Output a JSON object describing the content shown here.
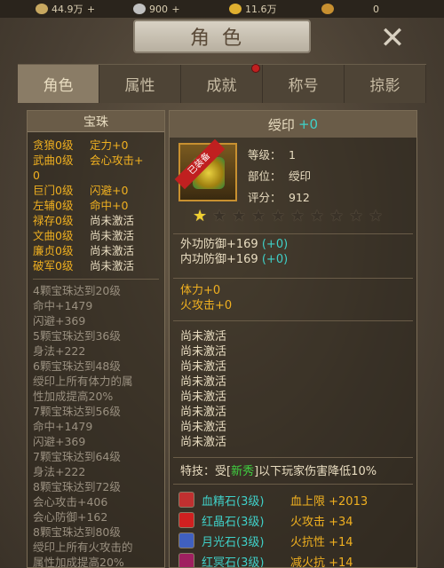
{
  "topbar": {
    "coins": "44.9万",
    "silver": "900",
    "gold": "11.6万",
    "bag": "0",
    "plus": "+"
  },
  "header": {
    "title": "角色",
    "close_icon": "close-icon"
  },
  "tabs": [
    {
      "label": "角色",
      "active": true
    },
    {
      "label": "属性",
      "active": false
    },
    {
      "label": "成就",
      "active": false
    },
    {
      "label": "称号",
      "active": false
    },
    {
      "label": "掠影",
      "active": false
    }
  ],
  "left_panel": {
    "header": "宝珠",
    "gems": [
      {
        "name": "贪狼0级",
        "value": "定力+0",
        "active": true
      },
      {
        "name": "武曲0级",
        "value": "会心攻击+",
        "active": true
      },
      {
        "name": "0",
        "value": "",
        "active": true
      },
      {
        "name": "巨门0级",
        "value": "闪避+0",
        "active": true
      },
      {
        "name": "左辅0级",
        "value": "命中+0",
        "active": true
      },
      {
        "name": "禄存0级",
        "value": "尚未激活",
        "active": false
      },
      {
        "name": "文曲0级",
        "value": "尚未激活",
        "active": false
      },
      {
        "name": "廉贞0级",
        "value": "尚未激活",
        "active": false
      },
      {
        "name": "破军0级",
        "value": "尚未激活",
        "active": false
      }
    ],
    "bonuses": [
      "4颗宝珠达到20级",
      "命中+1479",
      "闪避+369",
      "5颗宝珠达到36级",
      "身法+222",
      "6颗宝珠达到48级",
      "绶印上所有体力的属",
      "性加成提高20%",
      "7颗宝珠达到56级",
      "命中+1479",
      "闪避+369",
      "7颗宝珠达到64级",
      "身法+222",
      "8颗宝珠达到72级",
      "会心攻击+406",
      "会心防御+162",
      "8颗宝珠达到80级",
      "绶印上所有火攻击的",
      "属性加成提高20%"
    ]
  },
  "right_panel": {
    "name": "绶印",
    "level_plus": "+0",
    "equipped_badge": "已装备",
    "level_label": "等级：",
    "level": "1",
    "slot_label": "部位：",
    "slot": "绶印",
    "score_label": "评分：",
    "score": "912",
    "stars_lit": 1,
    "stars_total": 10,
    "base_attrs": [
      {
        "text": "外功防御+169",
        "bonus": "(+0)"
      },
      {
        "text": "内功防御+169",
        "bonus": "(+0)"
      }
    ],
    "extra_attrs": [
      "体力+0",
      "火攻击+0"
    ],
    "inactive": [
      "尚未激活",
      "尚未激活",
      "尚未激活",
      "尚未激活",
      "尚未激活",
      "尚未激活",
      "尚未激活",
      "尚未激活"
    ],
    "skill": {
      "label": "特技：",
      "prefix": "受[",
      "tag": "新秀",
      "suffix": "]以下玩家伤害降低10%"
    },
    "stones": [
      {
        "name": "血精石(3级)",
        "attr": "血上限 +2013",
        "color": "#c03030"
      },
      {
        "name": "红晶石(3级)",
        "attr": "火攻击 +34",
        "color": "#d02020"
      },
      {
        "name": "月光石(3级)",
        "attr": "火抗性 +14",
        "color": "#4060c0"
      },
      {
        "name": "红冥石(3级)",
        "attr": "减火抗 +14",
        "color": "#a02060"
      }
    ]
  }
}
